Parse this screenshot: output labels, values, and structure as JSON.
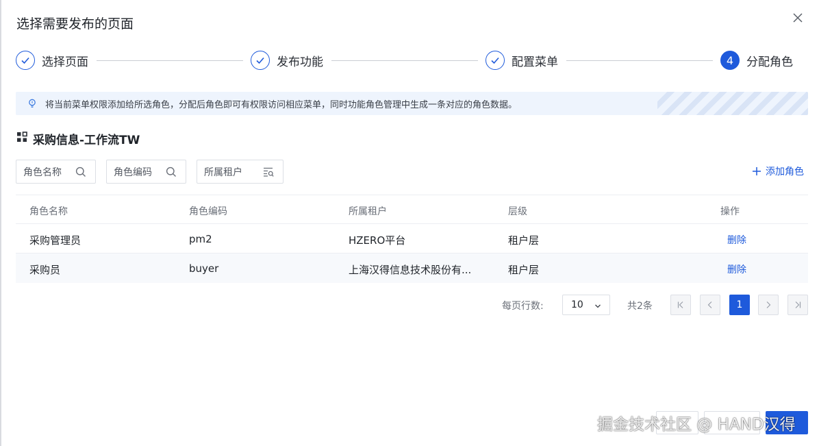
{
  "dialog": {
    "title": "选择需要发布的页面",
    "close_icon": "close-icon"
  },
  "steps": [
    {
      "label": "选择页面",
      "state": "done"
    },
    {
      "label": "发布功能",
      "state": "done"
    },
    {
      "label": "配置菜单",
      "state": "done"
    },
    {
      "label": "分配角色",
      "state": "active",
      "number": "4"
    }
  ],
  "info": {
    "icon": "lightbulb-icon",
    "text": "将当前菜单权限添加给所选角色，分配后角色即可有权限访问相应菜单，同时功能角色管理中生成一条对应的角色数据。"
  },
  "section": {
    "icon": "apps-icon",
    "title": "采购信息-工作流TW"
  },
  "filters": {
    "role_name": "角色名称",
    "role_code": "角色编码",
    "tenant": "所属租户",
    "add_role": "添加角色"
  },
  "table": {
    "columns": [
      "角色名称",
      "角色编码",
      "所属租户",
      "层级",
      "操作"
    ],
    "rows": [
      {
        "name": "采购管理员",
        "code": "pm2",
        "tenant": "HZERO平台",
        "level": "租户层",
        "action": "删除"
      },
      {
        "name": "采购员",
        "code": "buyer",
        "tenant": "上海汉得信息技术股份有...",
        "level": "租户层",
        "action": "删除"
      }
    ]
  },
  "pagination": {
    "rows_per_page_label": "每页行数:",
    "page_size": "10",
    "total": "共2条",
    "current_page": "1"
  },
  "watermark": "掘金技术社区 @ HAND汉得",
  "colors": {
    "primary": "#1e5adb",
    "info_bg": "#eef4fd"
  }
}
